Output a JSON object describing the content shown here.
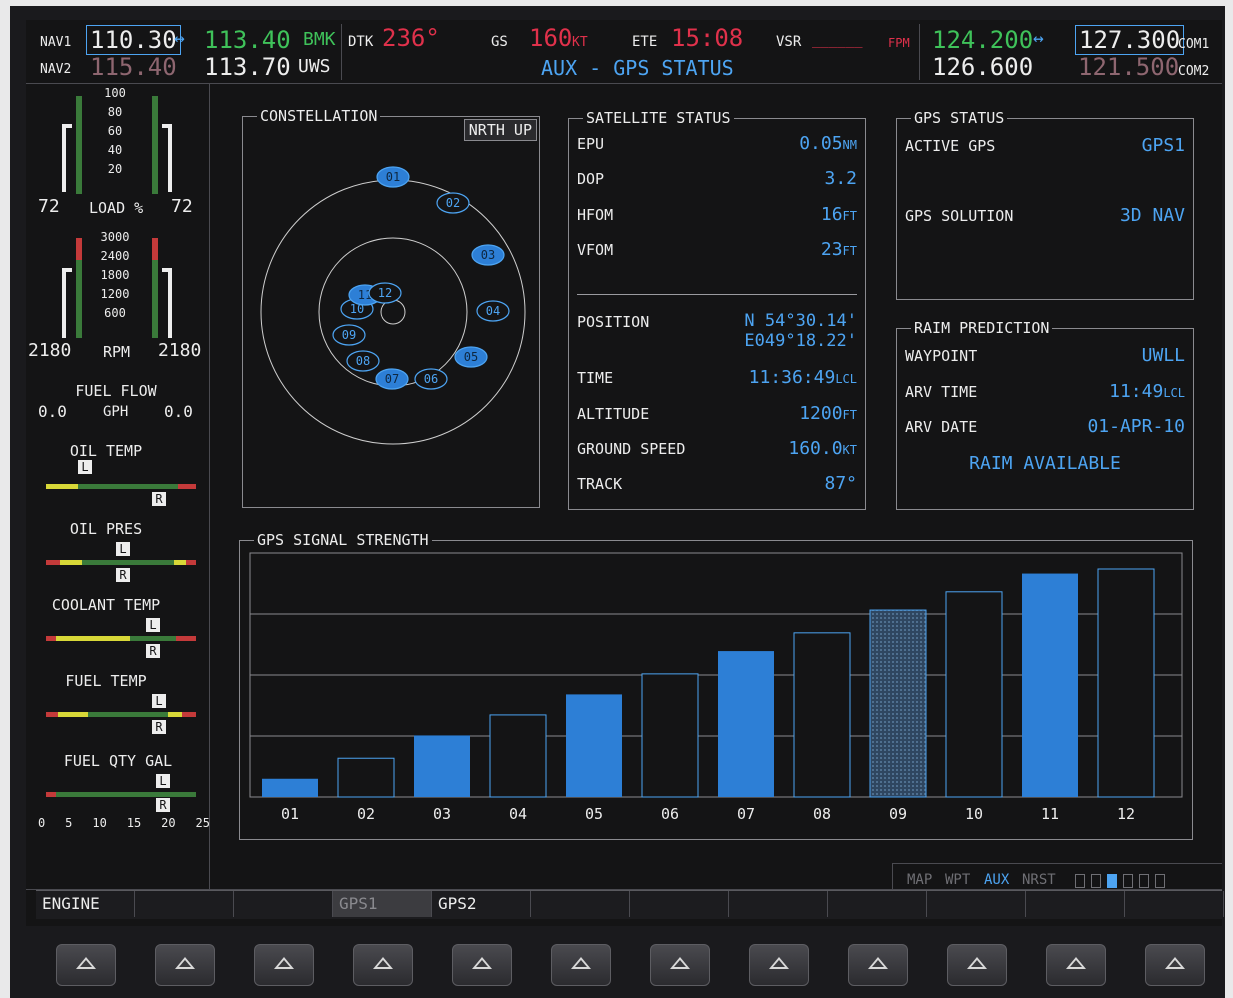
{
  "header": {
    "nav1_label": "NAV1",
    "nav1_active": "110.30",
    "nav1_swap_icon": "swap-arrow",
    "nav1_standby": "113.40",
    "nav1_ident": "BMK",
    "nav2_label": "NAV2",
    "nav2_active": "115.40",
    "nav2_standby": "113.70",
    "nav2_ident": "UWS",
    "dtk_label": "DTK",
    "dtk_value": "236°",
    "gs_label": "GS",
    "gs_value": "160",
    "gs_unit": "KT",
    "ete_label": "ETE",
    "ete_value": "15:08",
    "vsr_label": "VSR",
    "vsr_value": "______",
    "vsr_unit": "FPM",
    "page_title": "AUX - GPS STATUS",
    "com1_active": "124.200",
    "com1_swap_icon": "swap-arrow",
    "com1_standby": "127.300",
    "com1_label": "COM1",
    "com2_active": "126.600",
    "com2_standby": "121.500",
    "com2_label": "COM2"
  },
  "engine": {
    "load_ticks": [
      "100",
      "80",
      "60",
      "40",
      "20"
    ],
    "load_left": "72",
    "load_label": "LOAD %",
    "load_right": "72",
    "rpm_ticks": [
      "3000",
      "2400",
      "1800",
      "1200",
      "600"
    ],
    "rpm_left": "2180",
    "rpm_label": "RPM",
    "rpm_right": "2180",
    "fuel_flow_label": "FUEL FLOW",
    "fuel_flow_left": "0.0",
    "fuel_flow_unit": "GPH",
    "fuel_flow_right": "0.0",
    "oil_temp_label": "OIL TEMP",
    "oil_pres_label": "OIL PRES",
    "coolant_temp_label": "COOLANT TEMP",
    "fuel_temp_label": "FUEL TEMP",
    "fuel_qty_label": "FUEL QTY GAL",
    "fuel_qty_scale": [
      "0",
      "5",
      "10",
      "15",
      "20",
      "25"
    ],
    "pointer_left": "L",
    "pointer_right": "R"
  },
  "constellation": {
    "title": "CONSTELLATION",
    "orientation_button": "NRTH UP",
    "satellites": [
      {
        "id": "01",
        "filled": true
      },
      {
        "id": "02",
        "filled": false
      },
      {
        "id": "03",
        "filled": true
      },
      {
        "id": "04",
        "filled": false
      },
      {
        "id": "05",
        "filled": true
      },
      {
        "id": "06",
        "filled": false
      },
      {
        "id": "07",
        "filled": true
      },
      {
        "id": "08",
        "filled": false
      },
      {
        "id": "09",
        "filled": false
      },
      {
        "id": "10",
        "filled": false
      },
      {
        "id": "11",
        "filled": true
      },
      {
        "id": "12",
        "filled": false
      }
    ]
  },
  "satellite_status": {
    "title": "SATELLITE STATUS",
    "epu_label": "EPU",
    "epu_value": "0.05",
    "epu_unit": "NM",
    "dop_label": "DOP",
    "dop_value": "3.2",
    "hfom_label": "HFOM",
    "hfom_value": "16",
    "hfom_unit": "FT",
    "vfom_label": "VFOM",
    "vfom_value": "23",
    "vfom_unit": "FT",
    "position_label": "POSITION",
    "position_lat": "N 54°30.14'",
    "position_lon": "E049°18.22'",
    "time_label": "TIME",
    "time_value": "11:36:49",
    "time_unit": "LCL",
    "altitude_label": "ALTITUDE",
    "altitude_value": "1200",
    "altitude_unit": "FT",
    "ground_speed_label": "GROUND SPEED",
    "ground_speed_value": "160.0",
    "ground_speed_unit": "KT",
    "track_label": "TRACK",
    "track_value": "87°"
  },
  "gps_status": {
    "title": "GPS STATUS",
    "active_gps_label": "ACTIVE GPS",
    "active_gps_value": "GPS1",
    "solution_label": "GPS SOLUTION",
    "solution_value": "3D NAV"
  },
  "raim": {
    "title": "RAIM PREDICTION",
    "waypoint_label": "WAYPOINT",
    "waypoint_value": "UWLL",
    "arv_time_label": "ARV TIME",
    "arv_time_value": "11:49",
    "arv_time_unit": "LCL",
    "arv_date_label": "ARV DATE",
    "arv_date_value": "01-APR-10",
    "status": "RAIM AVAILABLE"
  },
  "signal_strength": {
    "title": "GPS SIGNAL STRENGTH",
    "bars": [
      {
        "id": "01",
        "level": 0.08,
        "style": "filled"
      },
      {
        "id": "02",
        "level": 0.17,
        "style": "outline"
      },
      {
        "id": "03",
        "level": 0.27,
        "style": "filled"
      },
      {
        "id": "04",
        "level": 0.36,
        "style": "outline"
      },
      {
        "id": "05",
        "level": 0.45,
        "style": "filled"
      },
      {
        "id": "06",
        "level": 0.54,
        "style": "outline"
      },
      {
        "id": "07",
        "level": 0.64,
        "style": "filled"
      },
      {
        "id": "08",
        "level": 0.72,
        "style": "outline"
      },
      {
        "id": "09",
        "level": 0.82,
        "style": "hatched"
      },
      {
        "id": "10",
        "level": 0.9,
        "style": "outline"
      },
      {
        "id": "11",
        "level": 0.98,
        "style": "filled"
      },
      {
        "id": "12",
        "level": 1.0,
        "style": "outline"
      }
    ]
  },
  "page_group": {
    "items": [
      "MAP",
      "WPT",
      "AUX",
      "NRST"
    ],
    "active": "AUX"
  },
  "softkeys": [
    "ENGINE",
    "",
    "",
    "GPS1",
    "GPS2",
    "",
    "",
    "",
    "",
    "",
    "",
    ""
  ],
  "colors": {
    "cyan": "#4da4f2",
    "magenta": "#e0314b",
    "green": "#3fc25a",
    "white": "#ededed",
    "gray": "#6f6f74"
  }
}
